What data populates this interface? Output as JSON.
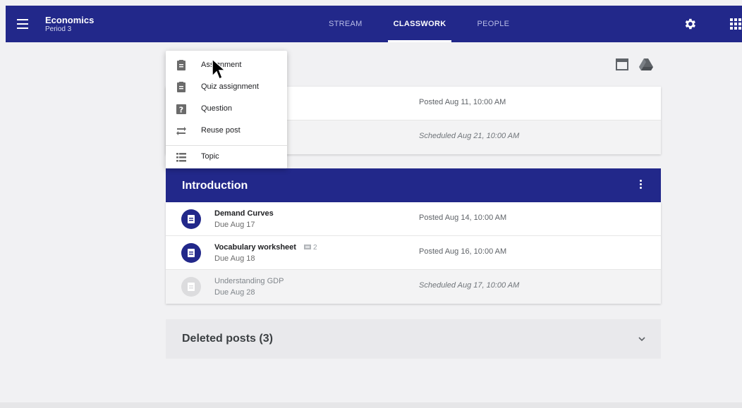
{
  "header": {
    "class_name": "Economics",
    "class_section": "Period 3",
    "tabs": [
      {
        "label": "STREAM",
        "active": false
      },
      {
        "label": "CLASSWORK",
        "active": true
      },
      {
        "label": "PEOPLE",
        "active": false
      }
    ]
  },
  "create_menu": {
    "items": [
      {
        "label": "Assignment",
        "icon": "assignment-icon"
      },
      {
        "label": "Quiz assignment",
        "icon": "quiz-assignment-icon"
      },
      {
        "label": "Question",
        "icon": "question-icon"
      },
      {
        "label": "Reuse post",
        "icon": "reuse-icon"
      },
      {
        "label": "Topic",
        "icon": "topic-icon"
      }
    ]
  },
  "top_card": {
    "rows": [
      {
        "status": "Posted Aug 11, 10:00 AM",
        "scheduled": false
      },
      {
        "status": "Scheduled Aug 21, 10:00 AM",
        "scheduled": true
      }
    ]
  },
  "topic": {
    "title": "Introduction",
    "items": [
      {
        "title": "Demand Curves",
        "due": "Due Aug 17",
        "status": "Posted Aug 14, 10:00 AM",
        "comments": ""
      },
      {
        "title": "Vocabulary worksheet",
        "due": "Due Aug 18",
        "status": "Posted Aug 16, 10:00 AM",
        "comments": "2"
      },
      {
        "title": "Understanding GDP",
        "due": "Due Aug 28",
        "status": "Scheduled Aug 17, 10:00 AM",
        "comments": ""
      }
    ]
  },
  "deleted_posts": {
    "label": "Deleted posts (3)"
  },
  "colors": {
    "brand": "#22288a",
    "background": "#f1f1f3"
  }
}
